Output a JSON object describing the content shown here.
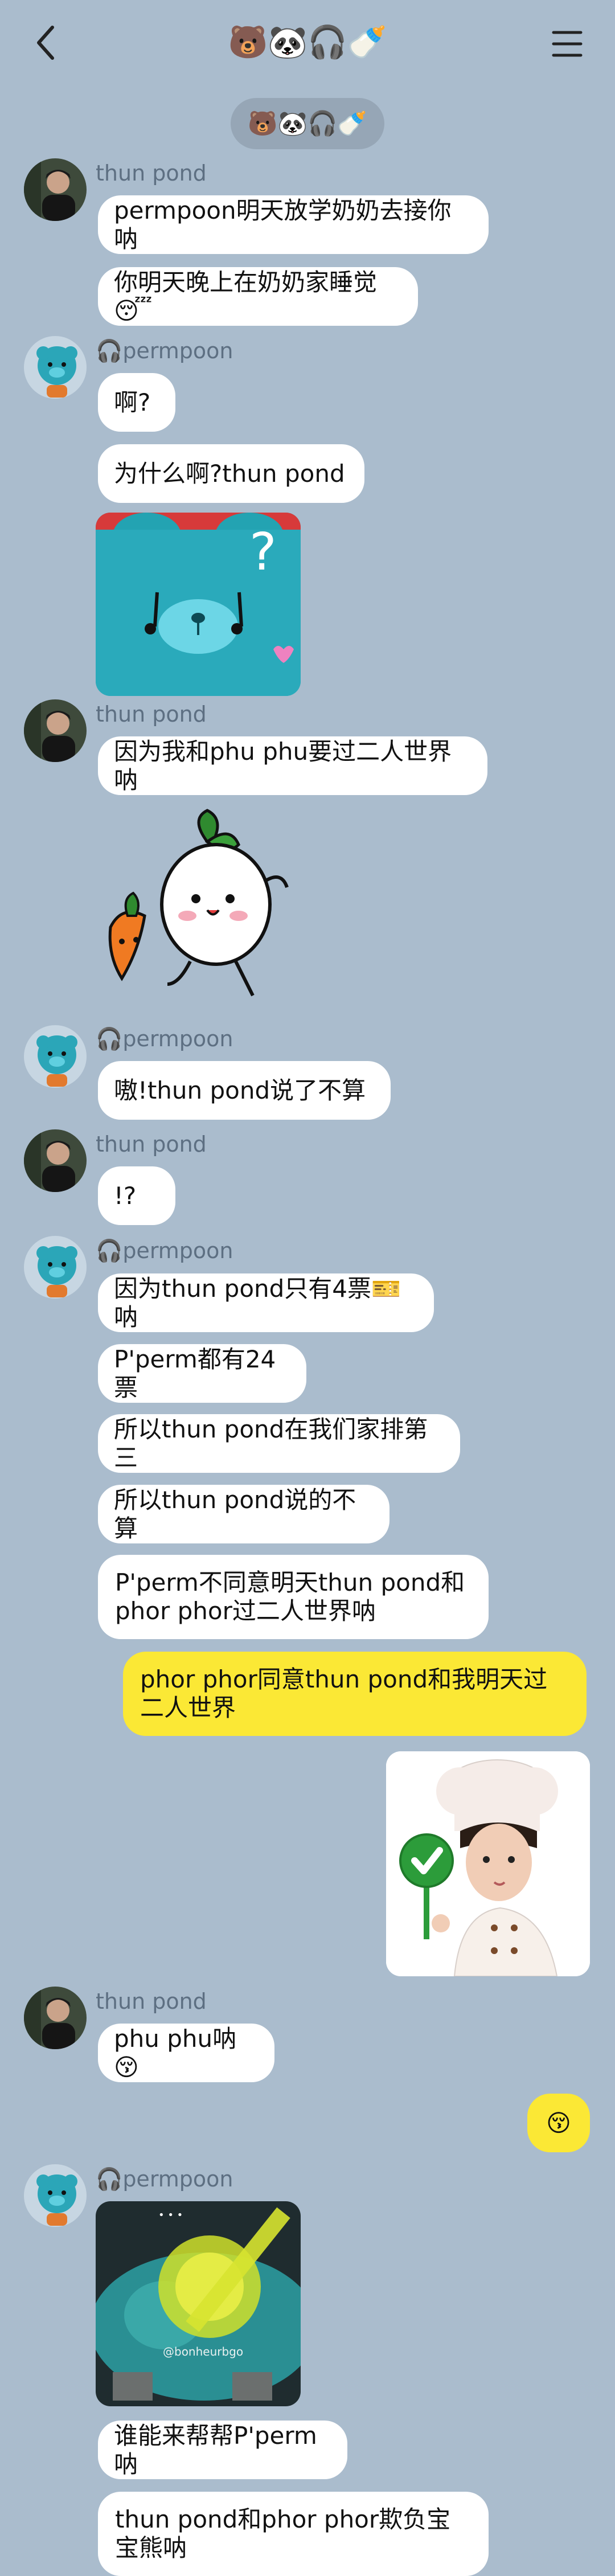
{
  "header": {
    "back_icon": "chevron-left-icon",
    "title": "🐻🐼🎧🍼",
    "menu_icon": "hamburger-menu-icon"
  },
  "members_chip": "🐻🐼🎧🍼",
  "senders": {
    "thun": "thun pond",
    "perm": "🎧permpoon"
  },
  "messages": {
    "m1": "permpoon明天放学奶奶去接你呐",
    "m2": "你明天晚上在奶奶家睡觉😴",
    "m3": "啊?",
    "m4": "为什么啊?thun pond",
    "m5": "因为我和phu phu要过二人世界呐",
    "m6": "嗷!thun pond说了不算",
    "m7": "!?",
    "m8": "因为thun pond只有4票🎫呐",
    "m9": "P'perm都有24票",
    "m10": "所以thun pond在我们家排第三",
    "m11": "所以thun pond说的不算",
    "m12": "P'perm不同意明天thun pond和phor phor过二人世界呐",
    "m13": "phor phor同意thun pond和我明天过二人世界",
    "m14": "phu phu呐😚",
    "m15": "😚",
    "m16": "谁能来帮帮P'perm呐",
    "m17": "thun pond和phor phor欺负宝宝熊呐"
  },
  "photo_watermark": "@bonheurbgo",
  "colors": {
    "background": "#aabccd",
    "bubble_other": "#ffffff",
    "bubble_me": "#fbe835",
    "name_text": "#5d6f82",
    "teal_toy": "#2ba6b8"
  }
}
